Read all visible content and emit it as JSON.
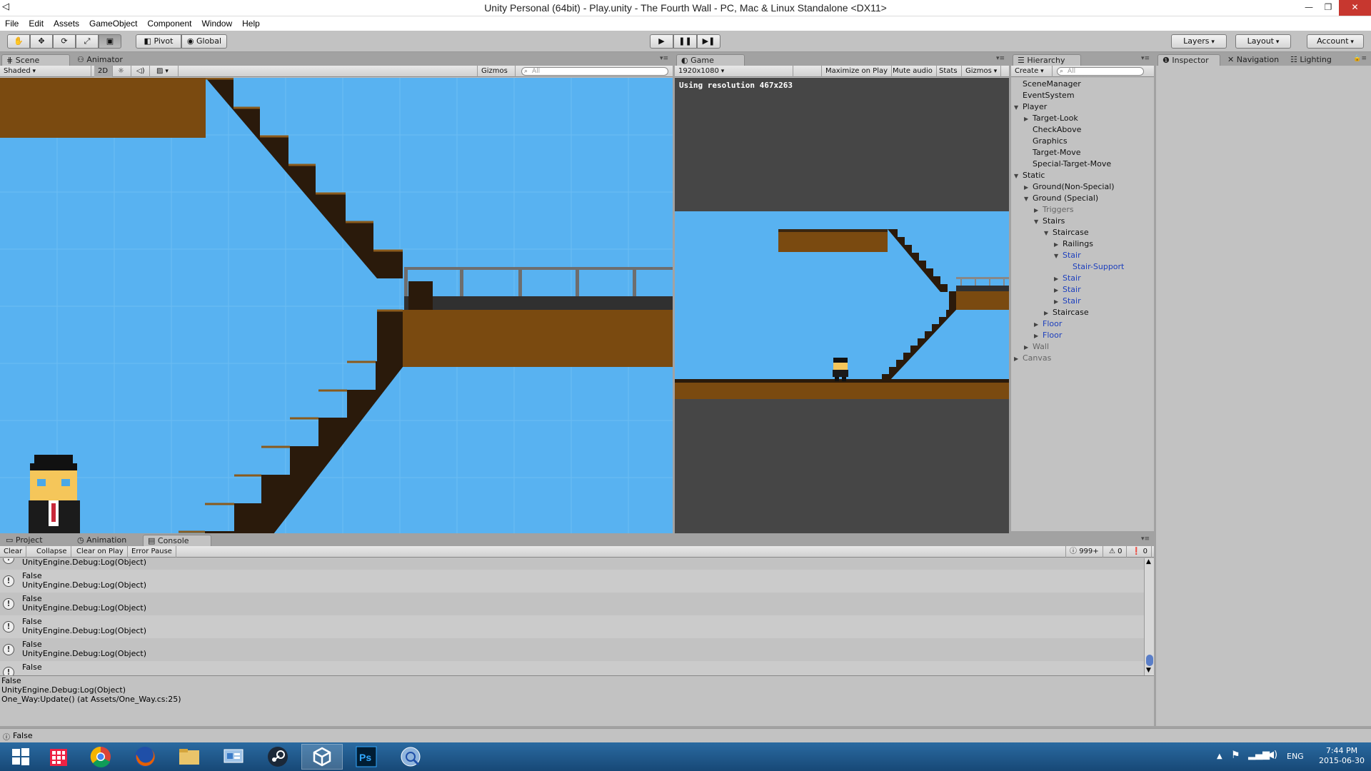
{
  "window": {
    "title": "Unity Personal (64bit) - Play.unity - The Fourth Wall - PC, Mac & Linux Standalone <DX11>",
    "minimize": "—",
    "restore": "❐",
    "close": "✕"
  },
  "menu": [
    "File",
    "Edit",
    "Assets",
    "GameObject",
    "Component",
    "Window",
    "Help"
  ],
  "toolbar": {
    "pivot": "Pivot",
    "global": "Global",
    "layers": "Layers",
    "layout": "Layout",
    "account": "Account"
  },
  "scene": {
    "tabs": [
      "Scene",
      "Animator"
    ],
    "shading": "Shaded",
    "mode_2d": "2D",
    "gizmos": "Gizmos",
    "search_placeholder": "All"
  },
  "game": {
    "tab": "Game",
    "resolution": "1920x1080",
    "maximize_on_play": "Maximize on Play",
    "mute_audio": "Mute audio",
    "stats": "Stats",
    "gizmos": "Gizmos",
    "resolution_notice": "Using resolution 467x263"
  },
  "hierarchy": {
    "tab": "Hierarchy",
    "create": "Create",
    "search_placeholder": "All",
    "items": [
      {
        "label": "SceneManager",
        "depth": 0,
        "arrow": "",
        "style": "normal"
      },
      {
        "label": "EventSystem",
        "depth": 0,
        "arrow": "",
        "style": "normal"
      },
      {
        "label": "Player",
        "depth": 0,
        "arrow": "open",
        "style": "normal"
      },
      {
        "label": "Target-Look",
        "depth": 1,
        "arrow": "closed",
        "style": "normal"
      },
      {
        "label": "CheckAbove",
        "depth": 1,
        "arrow": "",
        "style": "normal"
      },
      {
        "label": "Graphics",
        "depth": 1,
        "arrow": "",
        "style": "normal"
      },
      {
        "label": "Target-Move",
        "depth": 1,
        "arrow": "",
        "style": "normal"
      },
      {
        "label": "Special-Target-Move",
        "depth": 1,
        "arrow": "",
        "style": "normal"
      },
      {
        "label": "Static",
        "depth": 0,
        "arrow": "open",
        "style": "normal"
      },
      {
        "label": "Ground(Non-Special)",
        "depth": 1,
        "arrow": "closed",
        "style": "normal"
      },
      {
        "label": "Ground (Special)",
        "depth": 1,
        "arrow": "open",
        "style": "normal"
      },
      {
        "label": "Triggers",
        "depth": 2,
        "arrow": "closed",
        "style": "inactive"
      },
      {
        "label": "Stairs",
        "depth": 2,
        "arrow": "open",
        "style": "normal"
      },
      {
        "label": "Staircase",
        "depth": 3,
        "arrow": "open",
        "style": "normal"
      },
      {
        "label": "Railings",
        "depth": 4,
        "arrow": "closed",
        "style": "normal"
      },
      {
        "label": "Stair",
        "depth": 4,
        "arrow": "open",
        "style": "prefab"
      },
      {
        "label": "Stair-Support",
        "depth": 5,
        "arrow": "",
        "style": "prefab"
      },
      {
        "label": "Stair",
        "depth": 4,
        "arrow": "closed",
        "style": "prefab"
      },
      {
        "label": "Stair",
        "depth": 4,
        "arrow": "closed",
        "style": "prefab"
      },
      {
        "label": "Stair",
        "depth": 4,
        "arrow": "closed",
        "style": "prefab"
      },
      {
        "label": "Staircase",
        "depth": 3,
        "arrow": "closed",
        "style": "normal"
      },
      {
        "label": "Floor",
        "depth": 2,
        "arrow": "closed",
        "style": "prefab"
      },
      {
        "label": "Floor",
        "depth": 2,
        "arrow": "closed",
        "style": "prefab"
      },
      {
        "label": "Wall",
        "depth": 1,
        "arrow": "closed",
        "style": "inactive"
      },
      {
        "label": "Canvas",
        "depth": 0,
        "arrow": "closed",
        "style": "inactive"
      }
    ]
  },
  "inspector": {
    "tabs": [
      "Inspector",
      "Navigation",
      "Lighting"
    ]
  },
  "bottom": {
    "tabs": [
      "Project",
      "Animation",
      "Console"
    ],
    "buttons": [
      "Clear",
      "Collapse",
      "Clear on Play",
      "Error Pause"
    ],
    "counts": {
      "log": "999+",
      "warn": "0",
      "error": "0"
    }
  },
  "console": {
    "first_partial": "UnityEngine.Debug:Log(Object)",
    "rows": [
      {
        "message": "False",
        "trace": "UnityEngine.Debug:Log(Object)"
      },
      {
        "message": "False",
        "trace": "UnityEngine.Debug:Log(Object)"
      },
      {
        "message": "False",
        "trace": "UnityEngine.Debug:Log(Object)"
      },
      {
        "message": "False",
        "trace": "UnityEngine.Debug:Log(Object)"
      },
      {
        "message": "False",
        "trace": ""
      }
    ],
    "detail": [
      "False",
      "UnityEngine.Debug:Log(Object)",
      "One_Way:Update() (at Assets/One_Way.cs:25)"
    ],
    "status": "False"
  },
  "taskbar": {
    "lang": "ENG",
    "time": "7:44 PM",
    "date": "2015-06-30"
  },
  "colors": {
    "sky": "#58b2f1",
    "wood": "#7a4a10",
    "stair_dark": "#2a1a0b",
    "panel": "#c2c2c2",
    "prefab_blue": "#1c3fbd"
  }
}
